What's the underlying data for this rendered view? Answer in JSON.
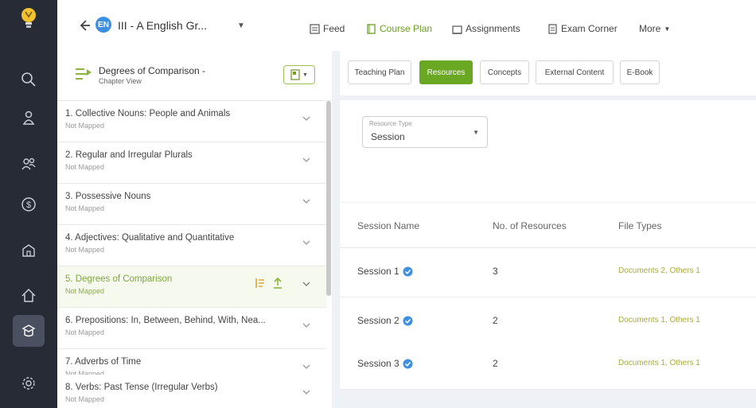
{
  "colors": {
    "rail_bg": "#262b36",
    "accent_green": "#6aa823",
    "link_olive": "#a9ab3b",
    "verified_blue": "#3d8fe0",
    "page_bg": "#eef1f6"
  },
  "sidebar": {
    "logo": "bulb-logo-icon",
    "items": [
      {
        "icon": "search-icon"
      },
      {
        "icon": "person-icon"
      },
      {
        "icon": "users-icon"
      },
      {
        "icon": "dollar-icon"
      },
      {
        "icon": "school-icon"
      },
      {
        "icon": "home-icon"
      },
      {
        "icon": "course-icon",
        "active": true
      },
      {
        "icon": "settings-icon"
      }
    ]
  },
  "header": {
    "class_badge": "EN",
    "class_name": "III - A  English Gr...",
    "tabs": [
      {
        "label": "Feed",
        "icon": "feed-icon"
      },
      {
        "label": "Course Plan",
        "icon": "book-icon",
        "active": true
      },
      {
        "label": "Assignments",
        "icon": "assignment-icon"
      },
      {
        "label": "Exam Corner",
        "icon": "exam-icon"
      },
      {
        "label": "More",
        "icon": "chevron-down-icon"
      }
    ]
  },
  "chapter_panel": {
    "title": "Degrees of Comparison -",
    "subtitle": "Chapter View",
    "chapters": [
      {
        "name": "1.  Collective Nouns: People and Animals",
        "status": "Not Mapped"
      },
      {
        "name": "2.  Regular and Irregular Plurals",
        "status": "Not Mapped"
      },
      {
        "name": "3.  Possessive Nouns",
        "status": "Not Mapped"
      },
      {
        "name": "4.  Adjectives: Qualitative and Quantitative",
        "status": "Not Mapped"
      },
      {
        "name": "5.  Degrees of Comparison",
        "status": "Not Mapped",
        "active": true
      },
      {
        "name": "6.  Prepositions: In, Between, Behind, With, Nea...",
        "status": "Not Mapped"
      },
      {
        "name": "7.  Adverbs of Time",
        "status": "Not Mapped"
      },
      {
        "name": "8.  Verbs: Past Tense (Irregular Verbs)",
        "status": "Not Mapped"
      }
    ]
  },
  "subtabs": [
    {
      "label": "Teaching Plan"
    },
    {
      "label": "Resources",
      "active": true
    },
    {
      "label": "Concepts"
    },
    {
      "label": "External Content"
    },
    {
      "label": "E-Book"
    }
  ],
  "resources": {
    "type_label": "Resource Type",
    "type_value": "Session",
    "columns": [
      "Session Name",
      "No. of Resources",
      "File Types"
    ],
    "rows": [
      {
        "session": "Session 1",
        "count": "3",
        "files": "Documents 2, Others 1"
      },
      {
        "session": "Session 2",
        "count": "2",
        "files": "Documents 1, Others 1"
      },
      {
        "session": "Session 3",
        "count": "2",
        "files": "Documents 1, Others 1"
      }
    ]
  }
}
